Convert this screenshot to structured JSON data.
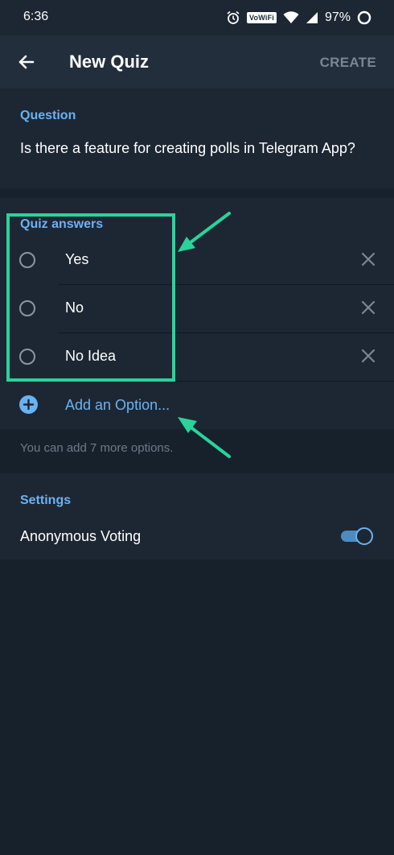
{
  "status_bar": {
    "time": "6:36",
    "wifi_badge": "VoWiFi",
    "battery": "97%",
    "icons": [
      "alarm-icon",
      "wifi-icon",
      "signal-icon",
      "battery-icon"
    ]
  },
  "app_bar": {
    "title": "New Quiz",
    "create_label": "CREATE",
    "back_icon": "arrow-left-icon"
  },
  "question": {
    "header": "Question",
    "text": "Is there a feature for creating polls in Telegram App?"
  },
  "answers": {
    "header": "Quiz answers",
    "options": [
      {
        "label": "Yes"
      },
      {
        "label": "No"
      },
      {
        "label": "No Idea"
      }
    ],
    "add_label": "Add an Option...",
    "hint": "You can add 7 more options."
  },
  "settings": {
    "header": "Settings",
    "anonymous_voting_label": "Anonymous Voting",
    "anonymous_voting_enabled": true
  },
  "colors": {
    "background": "#17212b",
    "section": "#1d2733",
    "accent": "#6ab3f3",
    "annotation": "#2ad39a"
  }
}
